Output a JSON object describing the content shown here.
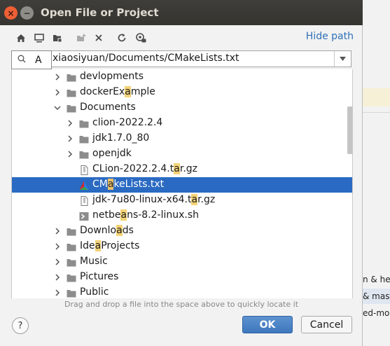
{
  "window": {
    "title": "Open File or Project"
  },
  "toolbar": {
    "hide_path": "Hide path"
  },
  "path_field": {
    "value": "xiaosiyuan/Documents/CMakeLists.txt",
    "search_query": "A"
  },
  "tree": {
    "items": [
      {
        "prefix": "devlopments",
        "match": "",
        "suffix": "",
        "icon": "folder-icon",
        "arrow": "collapsed"
      },
      {
        "prefix": "dockerEx",
        "match": "a",
        "suffix": "mple",
        "icon": "folder-icon",
        "arrow": "collapsed"
      },
      {
        "prefix": "Documents",
        "match": "",
        "suffix": "",
        "icon": "folder-icon",
        "arrow": "expanded"
      },
      {
        "prefix": "clion-2022.2.4",
        "match": "",
        "suffix": "",
        "icon": "folder-icon",
        "arrow": "collapsed"
      },
      {
        "prefix": "jdk1.7.0_80",
        "match": "",
        "suffix": "",
        "icon": "folder-icon",
        "arrow": "collapsed"
      },
      {
        "prefix": "openjdk",
        "match": "",
        "suffix": "",
        "icon": "folder-icon",
        "arrow": "collapsed"
      },
      {
        "prefix": "CLion-2022.2.4.t",
        "match": "a",
        "suffix": "r.gz",
        "icon": "archive-file-icon",
        "arrow": "none"
      },
      {
        "prefix": "CM",
        "match": "a",
        "suffix": "keLists.txt",
        "icon": "cmake-icon",
        "arrow": "none"
      },
      {
        "prefix": "jdk-7u80-linux-x64.t",
        "match": "a",
        "suffix": "r.gz",
        "icon": "archive-file-icon",
        "arrow": "none"
      },
      {
        "prefix": "netbe",
        "match": "a",
        "suffix": "ns-8.2-linux.sh",
        "icon": "shell-script-icon",
        "arrow": "none"
      },
      {
        "prefix": "Downlo",
        "match": "a",
        "suffix": "ds",
        "icon": "folder-icon",
        "arrow": "collapsed"
      },
      {
        "prefix": "Ide",
        "match": "a",
        "suffix": "Projects",
        "icon": "folder-icon",
        "arrow": "collapsed"
      },
      {
        "prefix": "Music",
        "match": "",
        "suffix": "",
        "icon": "folder-icon",
        "arrow": "collapsed"
      },
      {
        "prefix": "Pictures",
        "match": "",
        "suffix": "",
        "icon": "folder-icon",
        "arrow": "collapsed"
      },
      {
        "prefix": "Public",
        "match": "",
        "suffix": "",
        "icon": "folder-icon",
        "arrow": "collapsed"
      }
    ]
  },
  "hint": "Drag and drop a file into the space above to quickly locate it",
  "buttons": {
    "ok": "OK",
    "cancel": "Cancel",
    "help": "?"
  },
  "background": {
    "rows": [
      "n & he",
      "& mast",
      "ed-mo"
    ]
  },
  "colors": {
    "selection": "#2a6ac2",
    "match_highlight": "#f4d377",
    "link": "#2d70b8"
  }
}
